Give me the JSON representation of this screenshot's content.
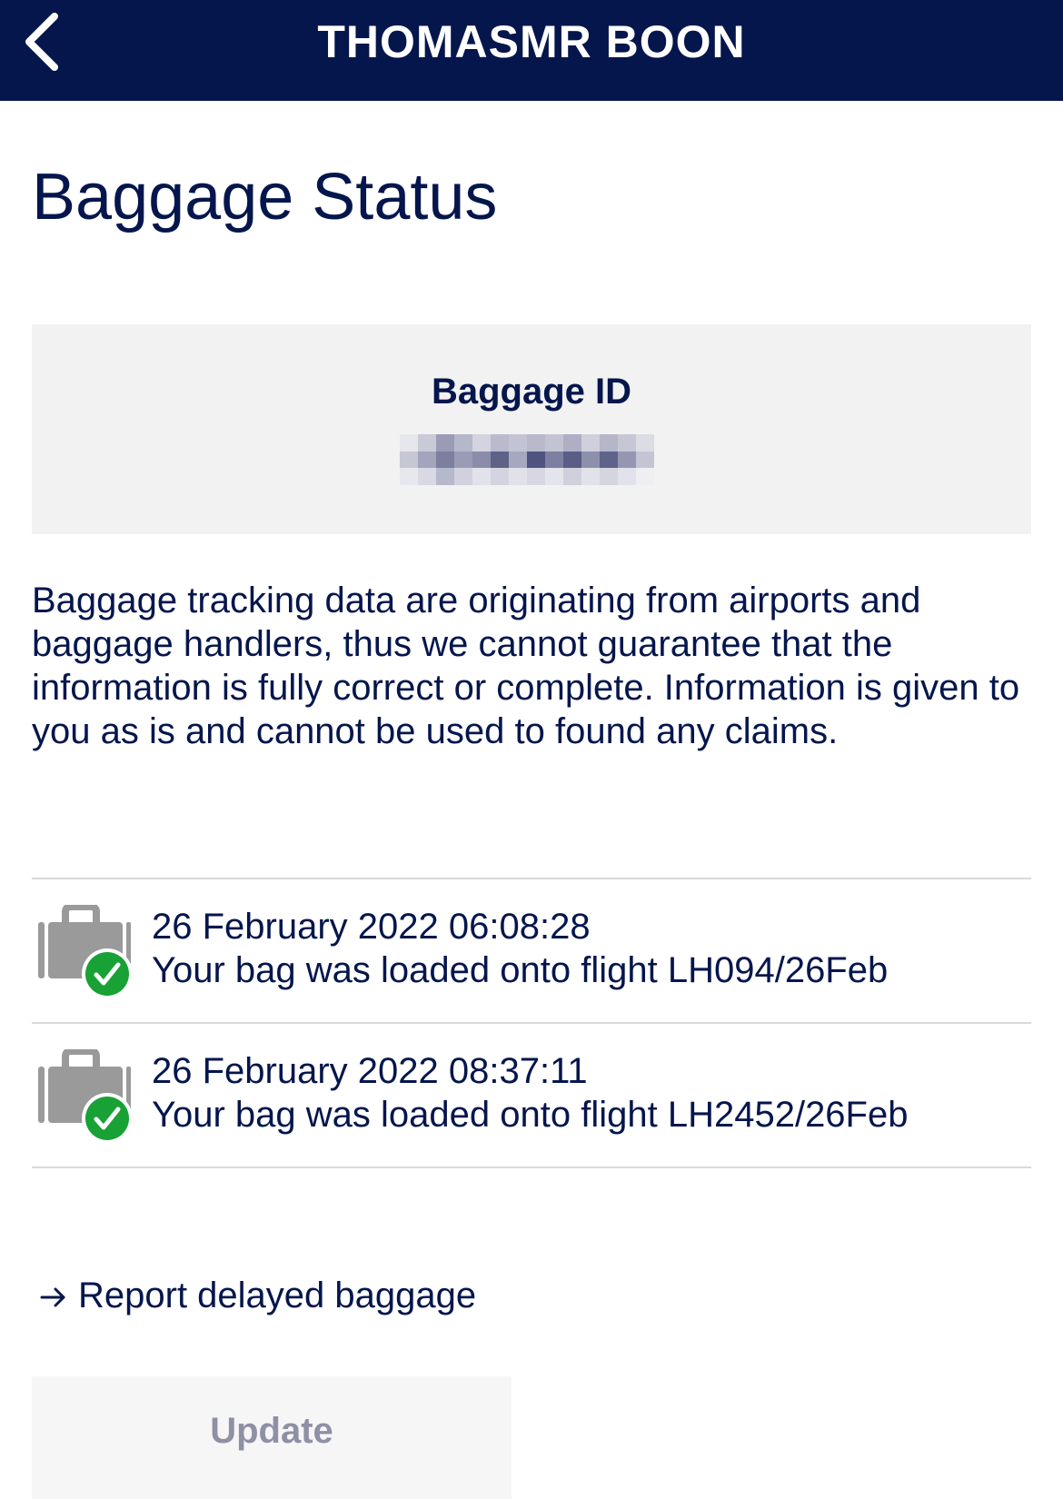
{
  "header": {
    "title": "THOMASMR BOON",
    "back_icon": "chevron-left-icon"
  },
  "page": {
    "title": "Baggage Status"
  },
  "baggage_id": {
    "label": "Baggage ID",
    "value_obscured": true
  },
  "disclaimer": "Baggage tracking data are originating from airports and baggage handlers, thus we cannot guarantee that the information is fully correct or complete. Information is given to you as is and cannot be used to found any claims.",
  "events": [
    {
      "icon": "bag-loaded-icon",
      "timestamp": "26 February 2022 06:08:28",
      "description": "Your bag was loaded onto flight LH094/26Feb"
    },
    {
      "icon": "bag-loaded-icon",
      "timestamp": "26 February 2022 08:37:11",
      "description": "Your bag was loaded onto flight LH2452/26Feb"
    }
  ],
  "actions": {
    "report_link": "Report delayed baggage",
    "report_icon": "arrow-right-icon",
    "update_button": "Update"
  },
  "colors": {
    "brand_navy": "#05164d",
    "panel_gray": "#f2f2f2",
    "divider": "#d9d9d9",
    "success_green": "#18a135",
    "bag_gray": "#9a9a9a",
    "disabled_text": "#8e90a6"
  }
}
